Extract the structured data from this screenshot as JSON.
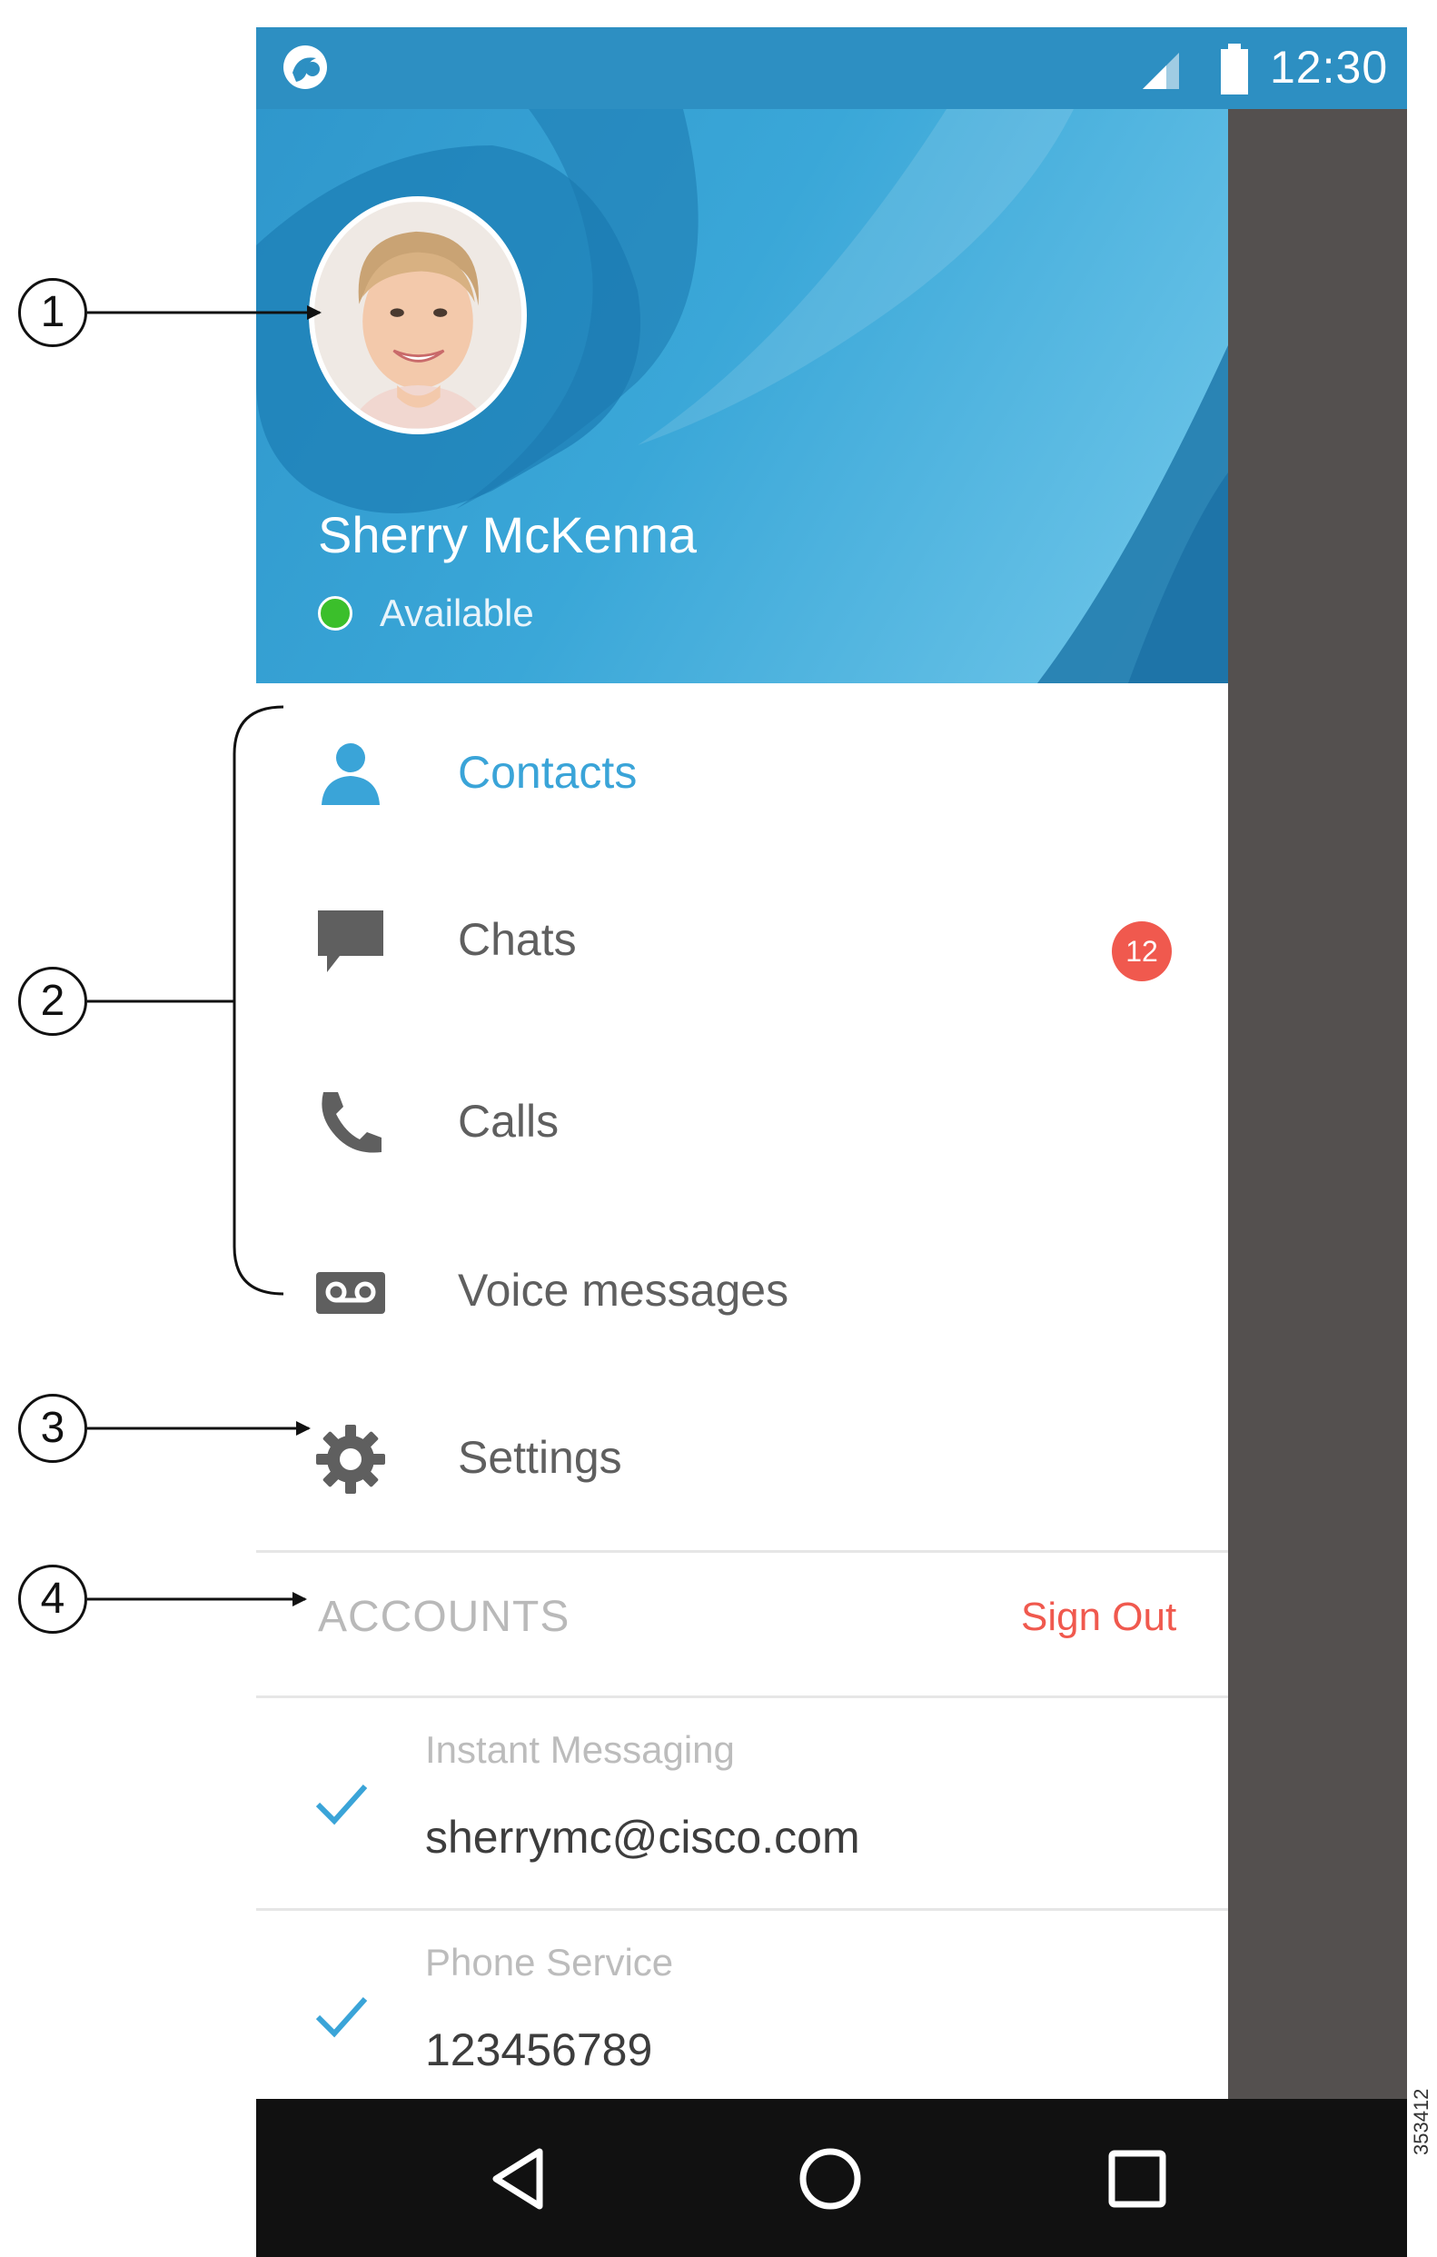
{
  "status_bar": {
    "time": "12:30",
    "icons": [
      "app-logo-icon",
      "signal-icon",
      "battery-icon"
    ]
  },
  "profile": {
    "name": "Sherry McKenna",
    "status": "Available",
    "status_color": "#3bbf2b"
  },
  "nav": {
    "items": [
      {
        "label": "Contacts",
        "icon": "person-icon",
        "active": true
      },
      {
        "label": "Chats",
        "icon": "chat-bubble-icon",
        "badge": "12"
      },
      {
        "label": "Calls",
        "icon": "phone-icon"
      },
      {
        "label": "Voice messages",
        "icon": "voicemail-icon"
      },
      {
        "label": "Settings",
        "icon": "gear-icon"
      }
    ]
  },
  "accounts": {
    "title": "ACCOUNTS",
    "sign_out_label": "Sign Out",
    "items": [
      {
        "type": "Instant Messaging",
        "value": "sherrymc@cisco.com"
      },
      {
        "type": "Phone Service",
        "value": "123456789"
      }
    ]
  },
  "callouts": [
    "1",
    "2",
    "3",
    "4"
  ],
  "figure_id": "353412",
  "colors": {
    "accent": "#3aa4d8",
    "badge": "#f0594e",
    "sign_out": "#f0594e",
    "scrim": "#54504f",
    "nav_bar": "#111111"
  }
}
